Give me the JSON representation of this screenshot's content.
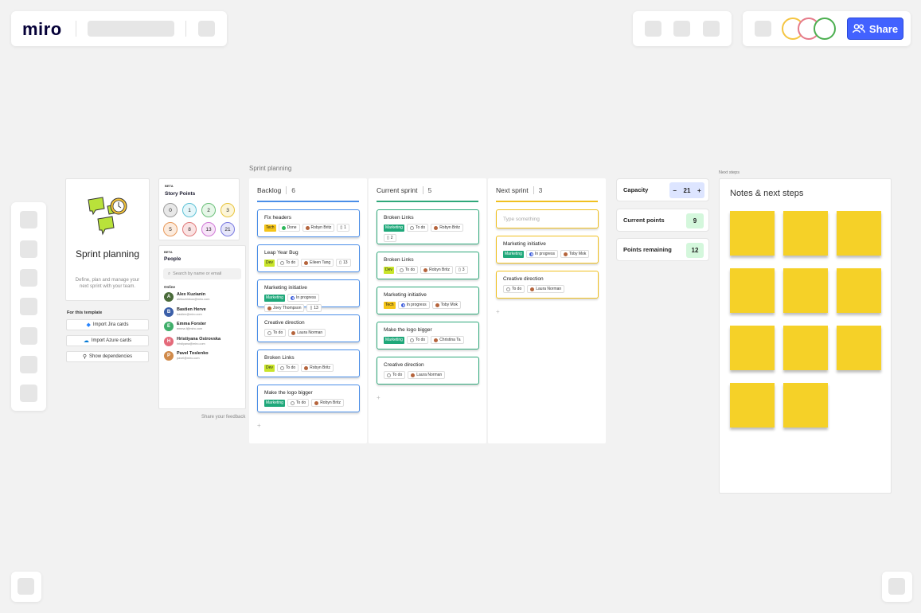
{
  "app": {
    "logo": "miro",
    "share_label": "Share"
  },
  "avatars": [
    {
      "color": "#f5c542"
    },
    {
      "color": "#e57b8a"
    },
    {
      "color": "#4caf50"
    }
  ],
  "board": {
    "label": "Sprint planning"
  },
  "intro": {
    "title": "Sprint planning",
    "description": "Define, plan and manage your next sprint with your team.",
    "template_label": "For this template",
    "buttons": [
      "Import Jira cards",
      "Import Azure cards",
      "Show dependencies"
    ]
  },
  "story_points": {
    "beta": "BETA",
    "title": "Story Points",
    "values": [
      {
        "label": "0",
        "color": "#9e9e9e",
        "bg": "#e8e8e8"
      },
      {
        "label": "1",
        "color": "#5fc2d6",
        "bg": "#e4f6fa"
      },
      {
        "label": "2",
        "color": "#6cc07a",
        "bg": "#e6f6e8"
      },
      {
        "label": "3",
        "color": "#e8c43c",
        "bg": "#fcf5d8"
      },
      {
        "label": "5",
        "color": "#e89a5c",
        "bg": "#fcebdd"
      },
      {
        "label": "8",
        "color": "#e07a7a",
        "bg": "#fae3e3"
      },
      {
        "label": "13",
        "color": "#d07ad6",
        "bg": "#f7e4f8"
      },
      {
        "label": "21",
        "color": "#7a7ae0",
        "bg": "#e6e6fa"
      }
    ]
  },
  "people": {
    "beta": "BETA",
    "title": "People",
    "search_placeholder": "Search by name or email",
    "online_label": "Online",
    "list": [
      {
        "name": "Alex Kuzianin",
        "email": "alekuzninkus@miro.com",
        "color": "#4a6b3a",
        "initial": "A"
      },
      {
        "name": "Bastien Herve",
        "email": "bastien@miro.com",
        "color": "#3b5fa8",
        "initial": "B"
      },
      {
        "name": "Emma Forster",
        "email": "emma.f@miro.com",
        "color": "#3fae6a",
        "initial": "E"
      },
      {
        "name": "Hristiyana Ostrovska",
        "email": "hristiyana@miro.com",
        "color": "#e46a7a",
        "initial": "H"
      },
      {
        "name": "Pavel Toslenko",
        "email": "pavel@miro.com",
        "color": "#d08a4a",
        "initial": "P"
      }
    ],
    "feedback": "Share your feedback"
  },
  "columns": [
    {
      "title": "Backlog",
      "count": "6",
      "color": "#4a8ee8",
      "cards": [
        {
          "title": "Fix headers",
          "tag": "Tech",
          "status": "Done",
          "assignee": "Robyn Britz",
          "points": "1"
        },
        {
          "title": "Leap Year Bug",
          "tag": "Dev",
          "status": "To do",
          "assignee": "Eileen Tang",
          "points": "13"
        },
        {
          "title": "Marketing initiative",
          "tag": "Marketing",
          "status": "In progress",
          "assignee": "Joey Thompson",
          "points": "13"
        },
        {
          "title": "Creative direction",
          "tag": "",
          "status": "To do",
          "assignee": "Laura Norman",
          "points": ""
        },
        {
          "title": "Broken Links",
          "tag": "Dev",
          "status": "To do",
          "assignee": "Robyn Britz",
          "points": ""
        },
        {
          "title": "Make the logo bigger",
          "tag": "Marketing",
          "status": "To do",
          "assignee": "Robyn Britz",
          "points": ""
        }
      ]
    },
    {
      "title": "Current sprint",
      "count": "5",
      "color": "#2fa87a",
      "cards": [
        {
          "title": "Broken Links",
          "tag": "Marketing",
          "status": "To do",
          "assignee": "Robyn Britz",
          "points": "2"
        },
        {
          "title": "Broken Links",
          "tag": "Dev",
          "status": "To do",
          "assignee": "Robyn Britz",
          "points": "3"
        },
        {
          "title": "Marketing initiative",
          "tag": "Tech",
          "status": "In progress",
          "assignee": "Toby Mok",
          "points": ""
        },
        {
          "title": "Make the logo bigger",
          "tag": "Marketing",
          "status": "To do",
          "assignee": "Christina Ta",
          "points": ""
        },
        {
          "title": "Creative direction",
          "tag": "",
          "status": "To do",
          "assignee": "Laura Norman",
          "points": ""
        }
      ]
    },
    {
      "title": "Next sprint",
      "count": "3",
      "color": "#f0c020",
      "input_placeholder": "Type something",
      "cards": [
        {
          "title": "Marketing initiative",
          "tag": "Marketing",
          "status": "In progress",
          "assignee": "Toby Mok",
          "points": ""
        },
        {
          "title": "Creative direction",
          "tag": "",
          "status": "To do",
          "assignee": "Laura Norman",
          "points": ""
        }
      ]
    }
  ],
  "tag_colors": {
    "Tech": {
      "bg": "#f5c518",
      "fg": "#222"
    },
    "Dev": {
      "bg": "#c9e52a",
      "fg": "#222"
    },
    "Marketing": {
      "bg": "#1fa87a",
      "fg": "#fff"
    }
  },
  "metrics": {
    "capacity": {
      "label": "Capacity",
      "value": "21",
      "minus": "−",
      "plus": "+"
    },
    "current": {
      "label": "Current points",
      "value": "9"
    },
    "remaining": {
      "label": "Points remaining",
      "value": "12"
    }
  },
  "notes": {
    "section_label": "Next steps",
    "title": "Notes & next steps",
    "sticky_count": 11
  }
}
